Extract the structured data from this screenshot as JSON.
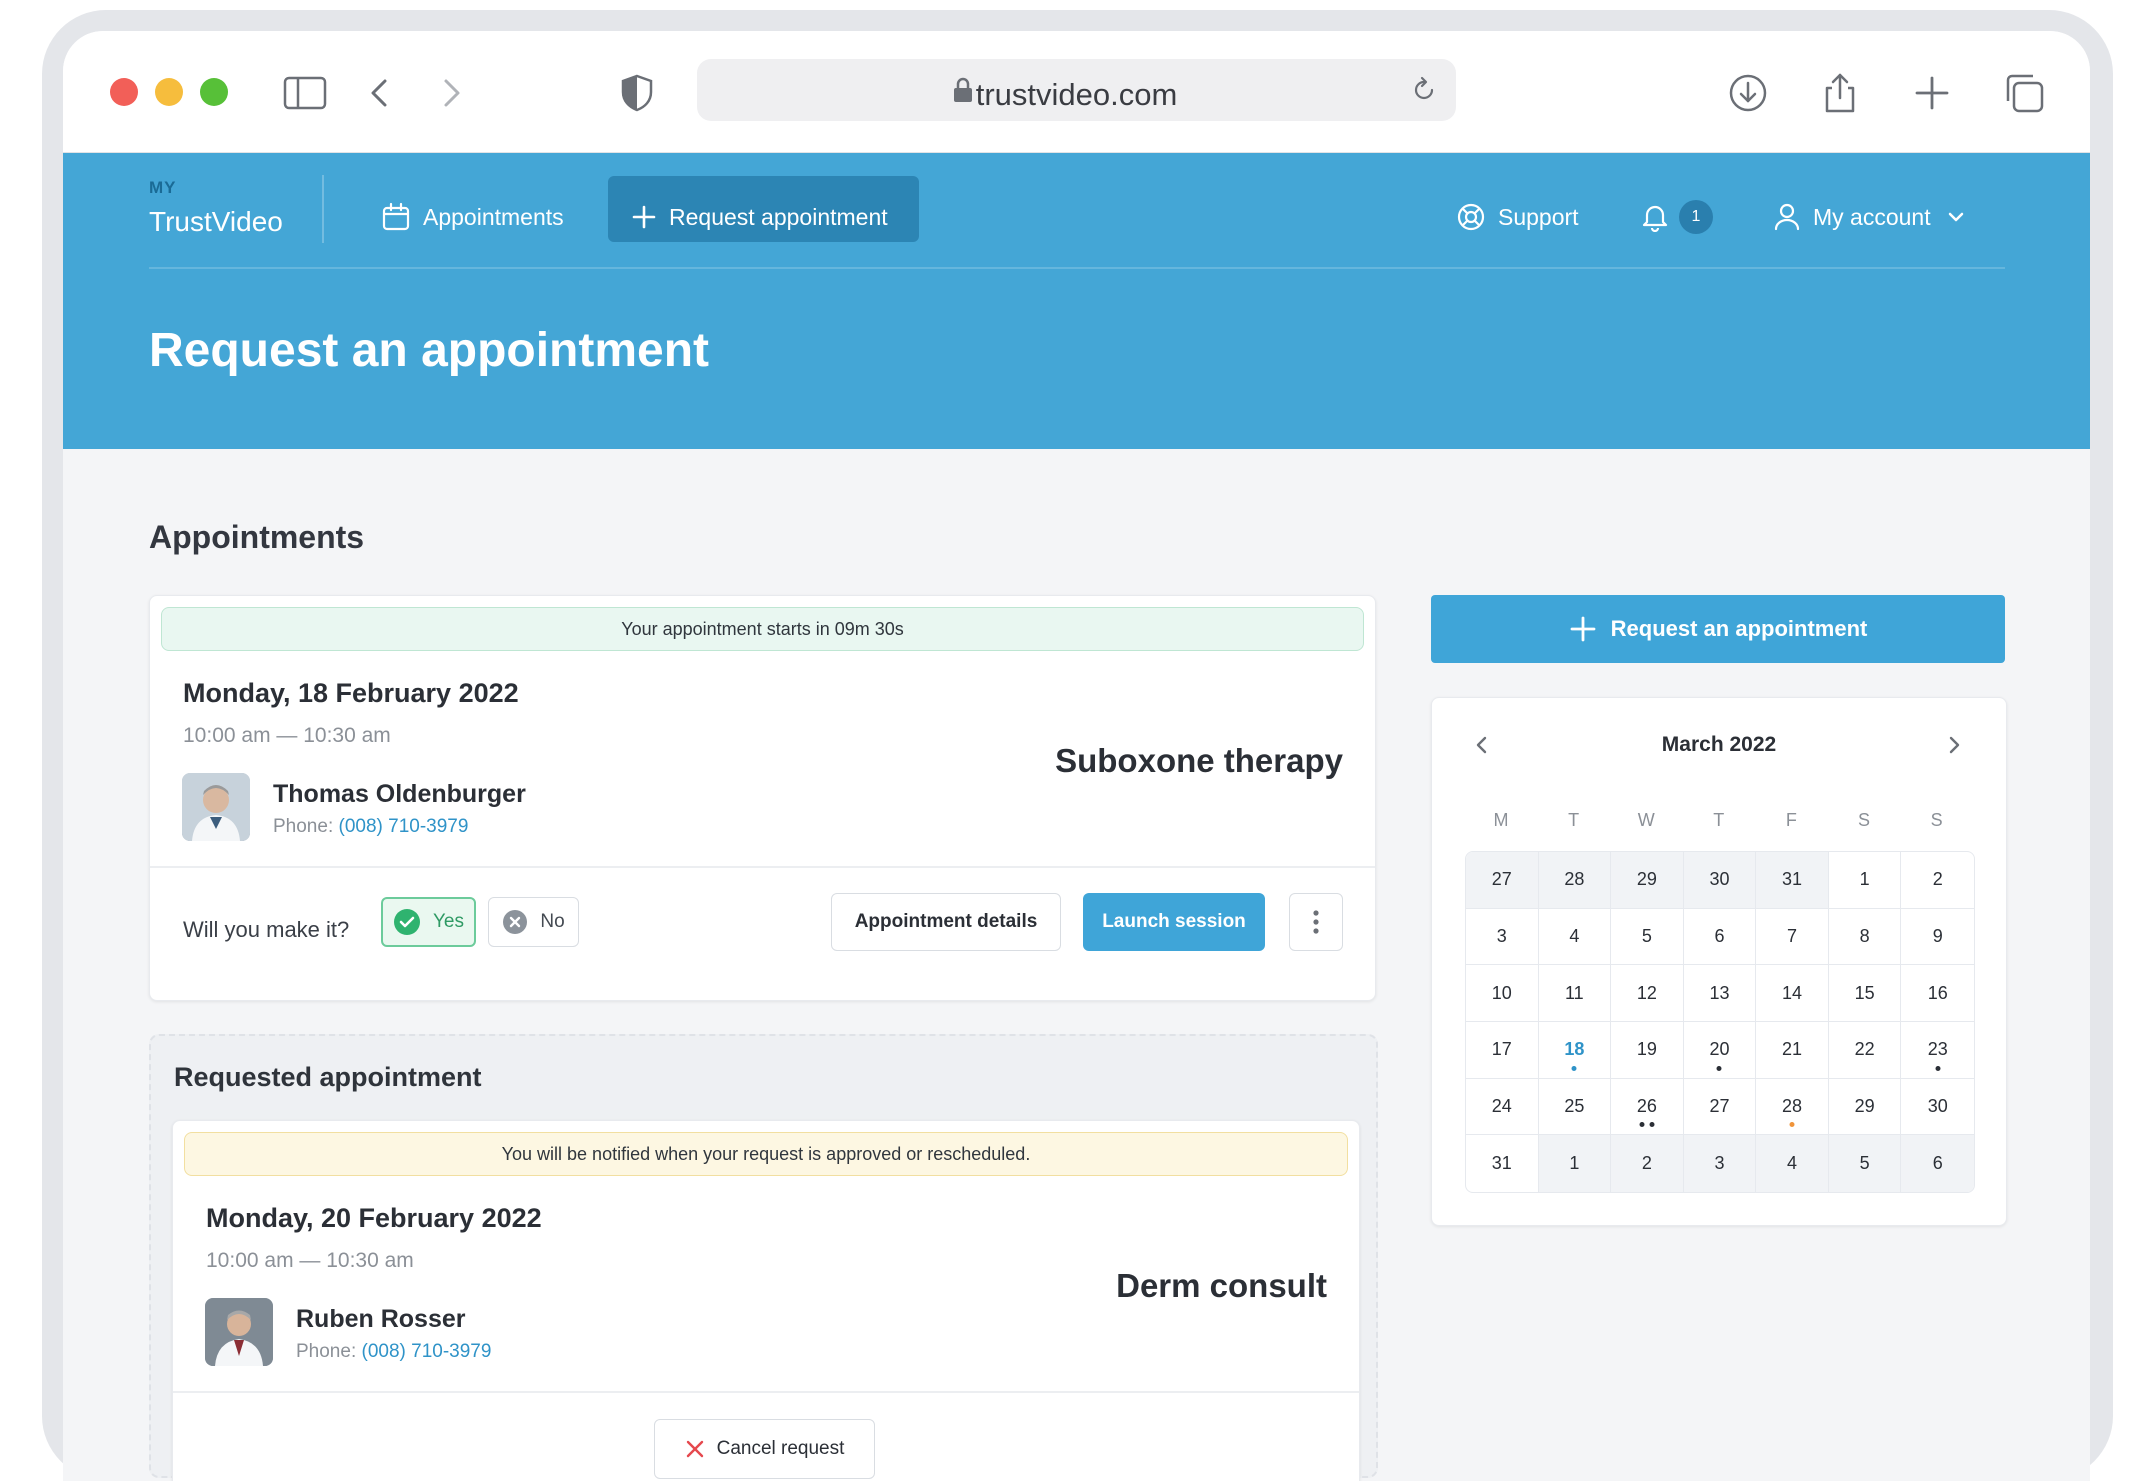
{
  "browser": {
    "url": "trustvideo.com"
  },
  "nav": {
    "logo_small": "MY",
    "logo_name": "TrustVideo",
    "appointments": "Appointments",
    "request_appointment": "Request appointment",
    "support": "Support",
    "notifications_count": "1",
    "my_account": "My account"
  },
  "page": {
    "title": "Request an appointment",
    "section_title": "Appointments"
  },
  "upcoming": {
    "banner": "Your appointment starts in 09m 30s",
    "date": "Monday, 18 February 2022",
    "time": "10:00 am — 10:30 am",
    "type": "Suboxone therapy",
    "doctor_name": "Thomas Oldenburger",
    "phone_label": "Phone:",
    "phone": "(008) 710-3979",
    "attend_question": "Will you make it?",
    "yes_label": "Yes",
    "no_label": "No",
    "details_label": "Appointment details",
    "launch_label": "Launch session"
  },
  "requested": {
    "title": "Requested appointment",
    "banner": "You will be notified when your request is approved or rescheduled.",
    "date": "Monday, 20 February 2022",
    "time": "10:00 am — 10:30 am",
    "type": "Derm consult",
    "doctor_name": "Ruben Rosser",
    "phone_label": "Phone:",
    "phone": "(008) 710-3979",
    "cancel_label": "Cancel request"
  },
  "sidebar": {
    "request_button": "Request an appointment"
  },
  "calendar": {
    "month": "March 2022",
    "weekdays": [
      "M",
      "T",
      "W",
      "T",
      "F",
      "S",
      "S"
    ],
    "weeks": [
      [
        {
          "d": "27",
          "muted": true
        },
        {
          "d": "28",
          "muted": true
        },
        {
          "d": "29",
          "muted": true
        },
        {
          "d": "30",
          "muted": true
        },
        {
          "d": "31",
          "muted": true
        },
        {
          "d": "1"
        },
        {
          "d": "2"
        }
      ],
      [
        {
          "d": "3"
        },
        {
          "d": "4"
        },
        {
          "d": "5"
        },
        {
          "d": "6"
        },
        {
          "d": "7"
        },
        {
          "d": "8"
        },
        {
          "d": "9"
        }
      ],
      [
        {
          "d": "10"
        },
        {
          "d": "11"
        },
        {
          "d": "12"
        },
        {
          "d": "13"
        },
        {
          "d": "14"
        },
        {
          "d": "15"
        },
        {
          "d": "16"
        }
      ],
      [
        {
          "d": "17"
        },
        {
          "d": "18",
          "today": true,
          "dots": [
            "blue"
          ]
        },
        {
          "d": "19"
        },
        {
          "d": "20",
          "dots": [
            "dark"
          ]
        },
        {
          "d": "21"
        },
        {
          "d": "22"
        },
        {
          "d": "23",
          "dots": [
            "dark"
          ]
        }
      ],
      [
        {
          "d": "24"
        },
        {
          "d": "25"
        },
        {
          "d": "26",
          "dots": [
            "dark",
            "dark"
          ]
        },
        {
          "d": "27"
        },
        {
          "d": "28",
          "dots": [
            "orange"
          ]
        },
        {
          "d": "29"
        },
        {
          "d": "30"
        }
      ],
      [
        {
          "d": "31"
        },
        {
          "d": "1",
          "muted": true
        },
        {
          "d": "2",
          "muted": true
        },
        {
          "d": "3",
          "muted": true
        },
        {
          "d": "4",
          "muted": true
        },
        {
          "d": "5",
          "muted": true
        },
        {
          "d": "6",
          "muted": true
        }
      ]
    ]
  },
  "colors": {
    "brand": "#44a6d6",
    "primary_button": "#3fa5d8",
    "success": "#2f9a64",
    "notice_yellow": "#fdf7e2"
  }
}
